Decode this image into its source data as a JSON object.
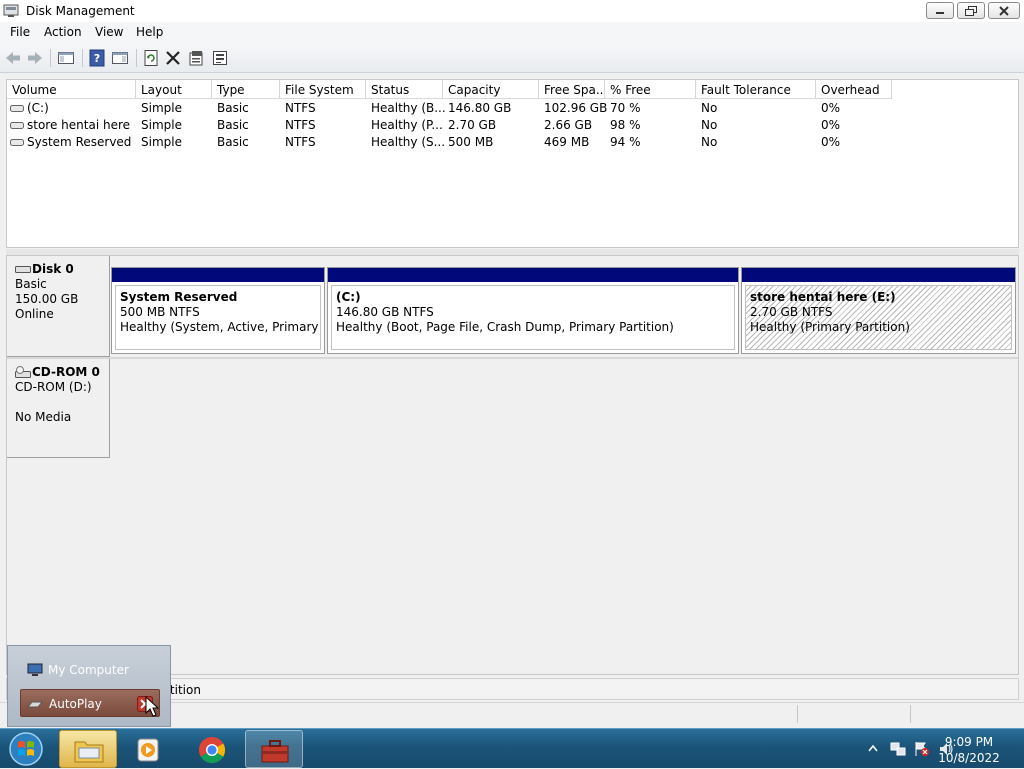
{
  "window": {
    "title": "Disk Management"
  },
  "menu": [
    "File",
    "Action",
    "View",
    "Help"
  ],
  "list": {
    "columns": [
      "Volume",
      "Layout",
      "Type",
      "File System",
      "Status",
      "Capacity",
      "Free Spa...",
      "% Free",
      "Fault Tolerance",
      "Overhead"
    ],
    "rows": [
      [
        "(C:)",
        "Simple",
        "Basic",
        "NTFS",
        "Healthy (B...",
        "146.80 GB",
        "102.96 GB",
        "70 %",
        "No",
        "0%"
      ],
      [
        "store hentai here (...",
        "Simple",
        "Basic",
        "NTFS",
        "Healthy (P...",
        "2.70 GB",
        "2.66 GB",
        "98 %",
        "No",
        "0%"
      ],
      [
        "System Reserved",
        "Simple",
        "Basic",
        "NTFS",
        "Healthy (S...",
        "500 MB",
        "469 MB",
        "94 %",
        "No",
        "0%"
      ]
    ]
  },
  "disks": [
    {
      "name": "Disk 0",
      "lines": [
        "Basic",
        "150.00 GB",
        "Online"
      ],
      "partitions": [
        {
          "name": "System Reserved",
          "size": "500 MB NTFS",
          "status": "Healthy (System, Active, Primary Partiti"
        },
        {
          "name": "(C:)",
          "size": "146.80 GB NTFS",
          "status": "Healthy (Boot, Page File, Crash Dump, Primary Partition)"
        },
        {
          "name": "store hentai here  (E:)",
          "size": "2.70 GB NTFS",
          "status": "Healthy (Primary Partition)"
        }
      ]
    },
    {
      "name": "CD-ROM 0",
      "lines": [
        "CD-ROM (D:)",
        "",
        "No Media"
      ]
    }
  ],
  "legend": {
    "text": "rtition"
  },
  "popup": {
    "items": [
      "My Computer",
      "AutoPlay"
    ]
  },
  "clock": {
    "time": "9:09 PM",
    "date": "10/8/2022"
  },
  "colors": {
    "partition_bar": "#00087a",
    "taskbar": "#1b5479"
  }
}
